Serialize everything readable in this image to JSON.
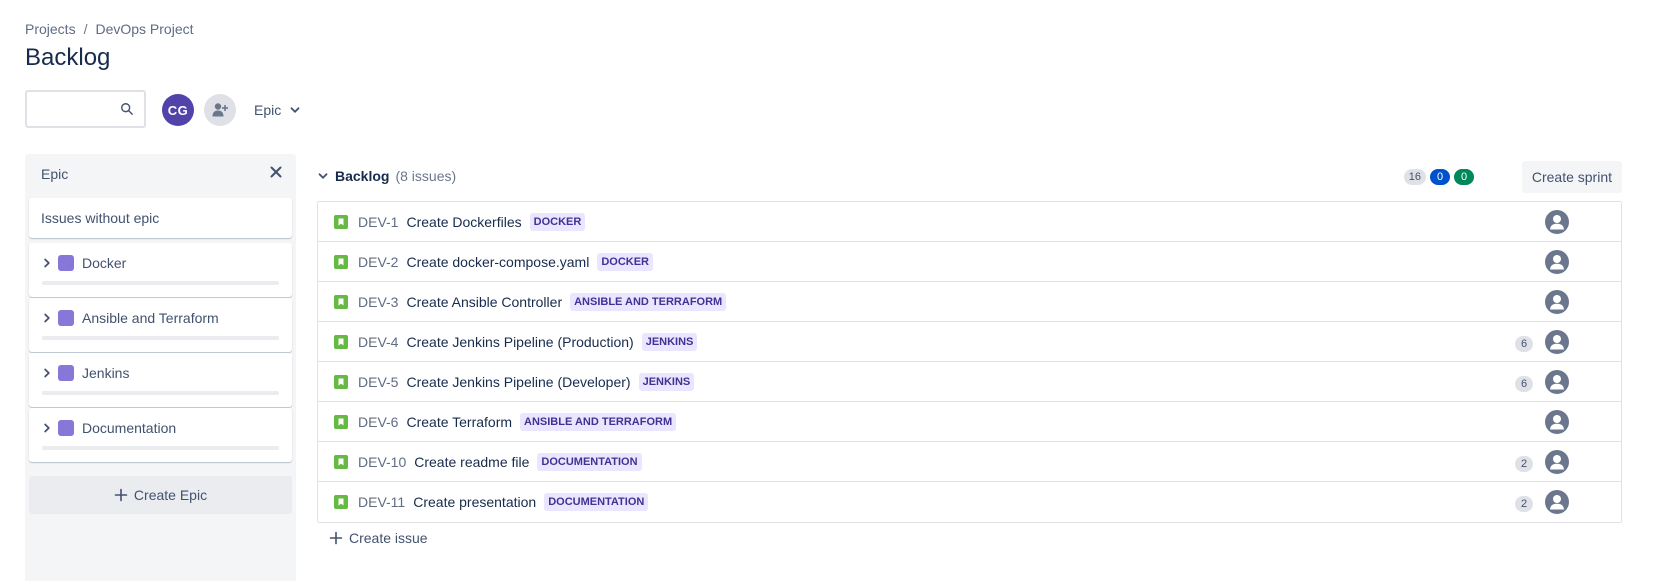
{
  "breadcrumb": {
    "projects": "Projects",
    "separator": "/",
    "project": "DevOps Project"
  },
  "page_title": "Backlog",
  "search": {
    "value": "",
    "placeholder": ""
  },
  "avatar": {
    "initials": "CG",
    "color": "#5243aa"
  },
  "epic_filter": {
    "label": "Epic"
  },
  "sidebar": {
    "header": "Epic",
    "no_epic_label": "Issues without epic",
    "epics": [
      {
        "name": "Docker",
        "color": "#8777d9"
      },
      {
        "name": "Ansible and Terraform",
        "color": "#8777d9"
      },
      {
        "name": "Jenkins",
        "color": "#8777d9"
      },
      {
        "name": "Documentation",
        "color": "#8777d9"
      }
    ],
    "create_epic_label": "Create Epic"
  },
  "backlog": {
    "title": "Backlog",
    "count_label": "(8 issues)",
    "counts": {
      "todo": "16",
      "in_progress": "0",
      "done": "0"
    },
    "create_sprint_label": "Create sprint",
    "issues": [
      {
        "key": "DEV-1",
        "summary": "Create Dockerfiles",
        "epic": "DOCKER",
        "points": ""
      },
      {
        "key": "DEV-2",
        "summary": "Create docker-compose.yaml",
        "epic": "DOCKER",
        "points": ""
      },
      {
        "key": "DEV-3",
        "summary": "Create Ansible Controller",
        "epic": "ANSIBLE AND TERRAFORM",
        "points": ""
      },
      {
        "key": "DEV-4",
        "summary": "Create Jenkins Pipeline (Production)",
        "epic": "JENKINS",
        "points": "6"
      },
      {
        "key": "DEV-5",
        "summary": "Create Jenkins Pipeline (Developer)",
        "epic": "JENKINS",
        "points": "6"
      },
      {
        "key": "DEV-6",
        "summary": "Create Terraform",
        "epic": "ANSIBLE AND TERRAFORM",
        "points": ""
      },
      {
        "key": "DEV-10",
        "summary": "Create readme file",
        "epic": "DOCUMENTATION",
        "points": "2"
      },
      {
        "key": "DEV-11",
        "summary": "Create presentation",
        "epic": "DOCUMENTATION",
        "points": "2"
      }
    ],
    "create_issue_label": "Create issue"
  },
  "colors": {
    "story": "#65ba43",
    "epic_lozenge_bg": "#eae6ff",
    "epic_lozenge_text": "#403294"
  }
}
